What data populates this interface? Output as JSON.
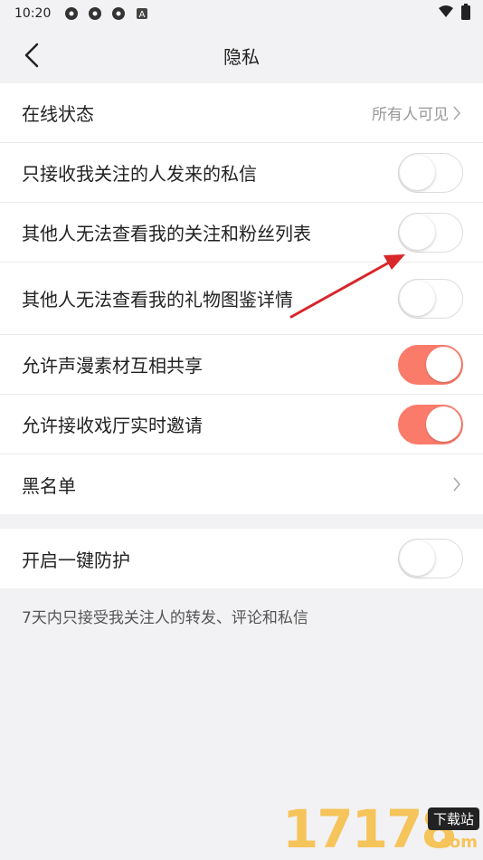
{
  "status_bar": {
    "time": "10:20",
    "notification_icons": [
      "app-icon",
      "app-icon",
      "app-icon",
      "a-icon"
    ],
    "right_icons": [
      "wifi-icon",
      "battery-icon"
    ]
  },
  "nav": {
    "title": "隐私",
    "back_icon": "chevron-left-icon"
  },
  "main_group": {
    "online_status": {
      "label": "在线状态",
      "value": "所有人可见"
    },
    "toggles": [
      {
        "label": "只接收我关注的人发来的私信",
        "on": false
      },
      {
        "label": "其他人无法查看我的关注和粉丝列表",
        "on": false
      },
      {
        "label": "其他人无法查看我的礼物图鉴详情",
        "on": false
      },
      {
        "label": "允许声漫素材互相共享",
        "on": true
      },
      {
        "label": "允许接收戏厅实时邀请",
        "on": true
      }
    ],
    "blacklist": {
      "label": "黑名单"
    }
  },
  "protect_group": {
    "label": "开启一键防护",
    "on": false,
    "note": "7天内只接受我关注人的转发、评论和私信"
  },
  "colors": {
    "accent_on": "#fa7b6a",
    "background": "#f2f2f4",
    "annotation_arrow": "#d9262a"
  },
  "watermark": {
    "number": "17178",
    "badge": "下载站",
    "suffix": ".com"
  }
}
